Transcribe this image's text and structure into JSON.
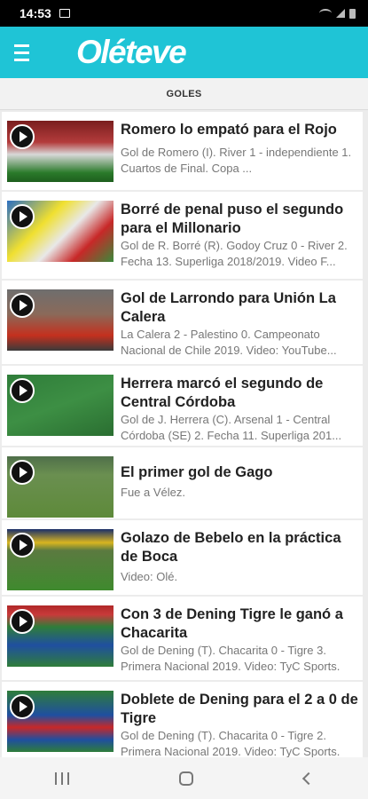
{
  "status": {
    "time": "14:53"
  },
  "app": {
    "logo": "Oléteve"
  },
  "tabs": {
    "active": "GOLES"
  },
  "items": [
    {
      "title": "Romero lo empató para el Rojo",
      "desc": "Gol de Romero (I). River 1 - independiente 1. Cuartos de Final. Copa ..."
    },
    {
      "title": "Borré de penal puso el segundo para el Millonario",
      "desc": "Gol de R. Borré (R). Godoy Cruz 0 - River 2. Fecha 13. Superliga 2018/2019. Video F..."
    },
    {
      "title": "Gol de Larrondo para Unión La Calera",
      "desc": "La Calera 2 - Palestino 0. Campeonato Nacional de Chile 2019. Video: YouTube..."
    },
    {
      "title": "Herrera marcó el segundo de Central Córdoba",
      "desc": "Gol de J. Herrera (C). Arsenal 1 - Central Córdoba (SE) 2. Fecha 11. Superliga 201..."
    },
    {
      "title": "El primer gol de Gago",
      "desc": "Fue a Vélez."
    },
    {
      "title": "Golazo de Bebelo en la práctica de Boca",
      "desc": "Video: Olé."
    },
    {
      "title": "Con 3 de Dening Tigre le ganó a Chacarita",
      "desc": "Gol de Dening (T). Chacarita 0 - Tigre 3. Primera Nacional 2019. Video: TyC Sports."
    },
    {
      "title": "Doblete de Dening para el 2 a 0 de Tigre",
      "desc": "Gol de Dening (T). Chacarita 0 - Tigre 2. Primera Nacional 2019. Video: TyC Sports."
    }
  ]
}
